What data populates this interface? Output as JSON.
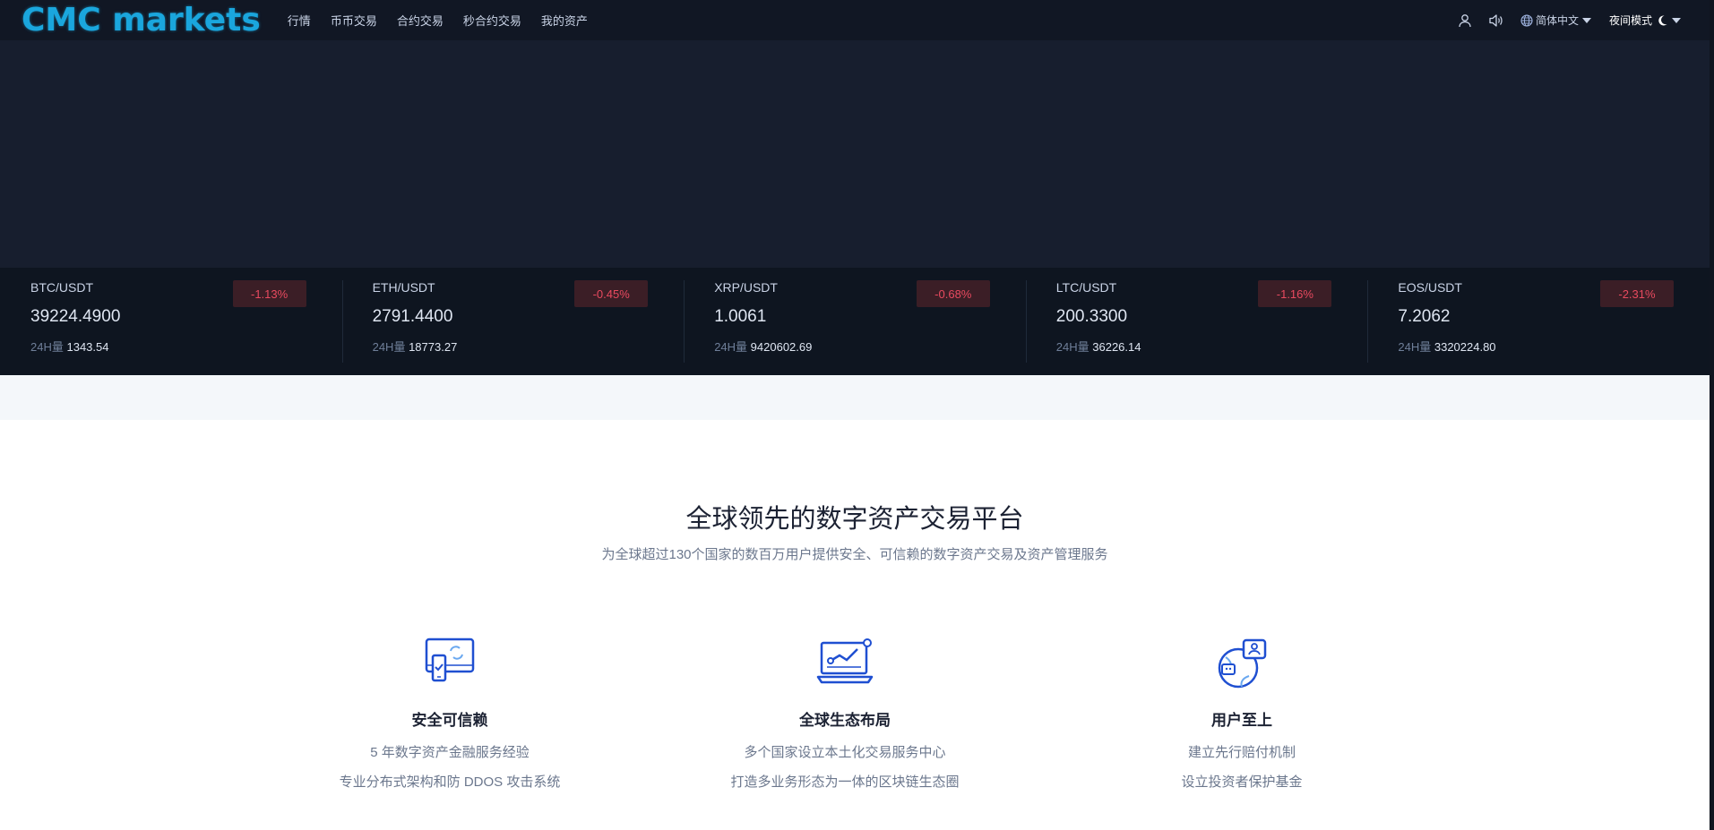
{
  "header": {
    "logo": "CMC markets",
    "nav": [
      "行情",
      "币币交易",
      "合约交易",
      "秒合约交易",
      "我的资产"
    ],
    "language": "简体中文",
    "mode": "夜间模式",
    "icons": [
      "user-icon",
      "speaker-icon",
      "globe-icon",
      "moon-icon"
    ]
  },
  "ticker": [
    {
      "pair": "BTC/USDT",
      "change": "-1.13%",
      "price": "39224.4900",
      "vol_label": "24H量",
      "vol": "1343.54"
    },
    {
      "pair": "ETH/USDT",
      "change": "-0.45%",
      "price": "2791.4400",
      "vol_label": "24H量",
      "vol": "18773.27"
    },
    {
      "pair": "XRP/USDT",
      "change": "-0.68%",
      "price": "1.0061",
      "vol_label": "24H量",
      "vol": "9420602.69"
    },
    {
      "pair": "LTC/USDT",
      "change": "-1.16%",
      "price": "200.3300",
      "vol_label": "24H量",
      "vol": "36226.14"
    },
    {
      "pair": "EOS/USDT",
      "change": "-2.31%",
      "price": "7.2062",
      "vol_label": "24H量",
      "vol": "3320224.80"
    }
  ],
  "intro": {
    "title": "全球领先的数字资产交易平台",
    "subtitle": "为全球超过130个国家的数百万用户提供安全、可信赖的数字资产交易及资产管理服务"
  },
  "features": [
    {
      "title": "安全可信赖",
      "lines": [
        "5 年数字资产金融服务经验",
        "专业分布式架构和防 DDOS 攻击系统"
      ],
      "icon": "secure-device-icon"
    },
    {
      "title": "全球生态布局",
      "lines": [
        "多个国家设立本土化交易服务中心",
        "打造多业务形态为一体的区块链生态圈"
      ],
      "icon": "chart-laptop-icon"
    },
    {
      "title": "用户至上",
      "lines": [
        "建立先行赔付机制",
        "设立投资者保护基金"
      ],
      "icon": "user-support-icon"
    }
  ],
  "colors": {
    "header_bg": "#111724",
    "banner_bg": "#171e2e",
    "ticker_bg": "#0e1520",
    "logo": "#1aa6dd",
    "negative": "#e84a5f",
    "icon_blue": "#1f4fd1"
  }
}
